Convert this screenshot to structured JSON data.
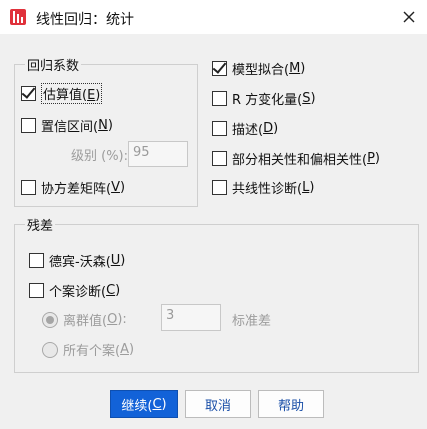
{
  "window": {
    "title": "线性回归：统计",
    "close_icon": "close-icon",
    "app_icon": "spss-dialog-icon"
  },
  "coefficients": {
    "group_title": "回归系数",
    "estimates": {
      "label": "估算值(",
      "mnemonic": "E",
      "suffix": ")",
      "checked": true
    },
    "confidence": {
      "label": "置信区间(",
      "mnemonic": "N",
      "suffix": ")",
      "checked": false
    },
    "level_label": "级别 (%):",
    "level_value": "95",
    "covariance": {
      "label": "协方差矩阵(",
      "mnemonic": "V",
      "suffix": ")",
      "checked": false
    }
  },
  "options": [
    {
      "label": "模型拟合(",
      "mnemonic": "M",
      "suffix": ")",
      "checked": true
    },
    {
      "label": "R 方变化量(",
      "mnemonic": "S",
      "suffix": ")",
      "checked": false
    },
    {
      "label": "描述(",
      "mnemonic": "D",
      "suffix": ")",
      "checked": false
    },
    {
      "label": "部分相关性和偏相关性(",
      "mnemonic": "P",
      "suffix": ")",
      "checked": false
    },
    {
      "label": "共线性诊断(",
      "mnemonic": "L",
      "suffix": ")",
      "checked": false
    }
  ],
  "residuals": {
    "group_title": "残差",
    "durbin": {
      "label": "德宾-沃森(",
      "mnemonic": "U",
      "suffix": ")",
      "checked": false
    },
    "casewise": {
      "label": "个案诊断(",
      "mnemonic": "C",
      "suffix": ")",
      "checked": false
    },
    "outliers": {
      "label": "离群值(",
      "mnemonic": "O",
      "suffix": "):",
      "selected": true
    },
    "outlier_value": "3",
    "std_dev_label": "标准差",
    "all_cases": {
      "label": "所有个案(",
      "mnemonic": "A",
      "suffix": ")",
      "selected": false
    }
  },
  "buttons": {
    "continue": {
      "label": "继续(",
      "mnemonic": "C",
      "suffix": ")"
    },
    "cancel": "取消",
    "help": "帮助"
  },
  "colors": {
    "primary": "#1262d8",
    "background": "#f0f0f0",
    "disabled": "#9c9c9c"
  }
}
